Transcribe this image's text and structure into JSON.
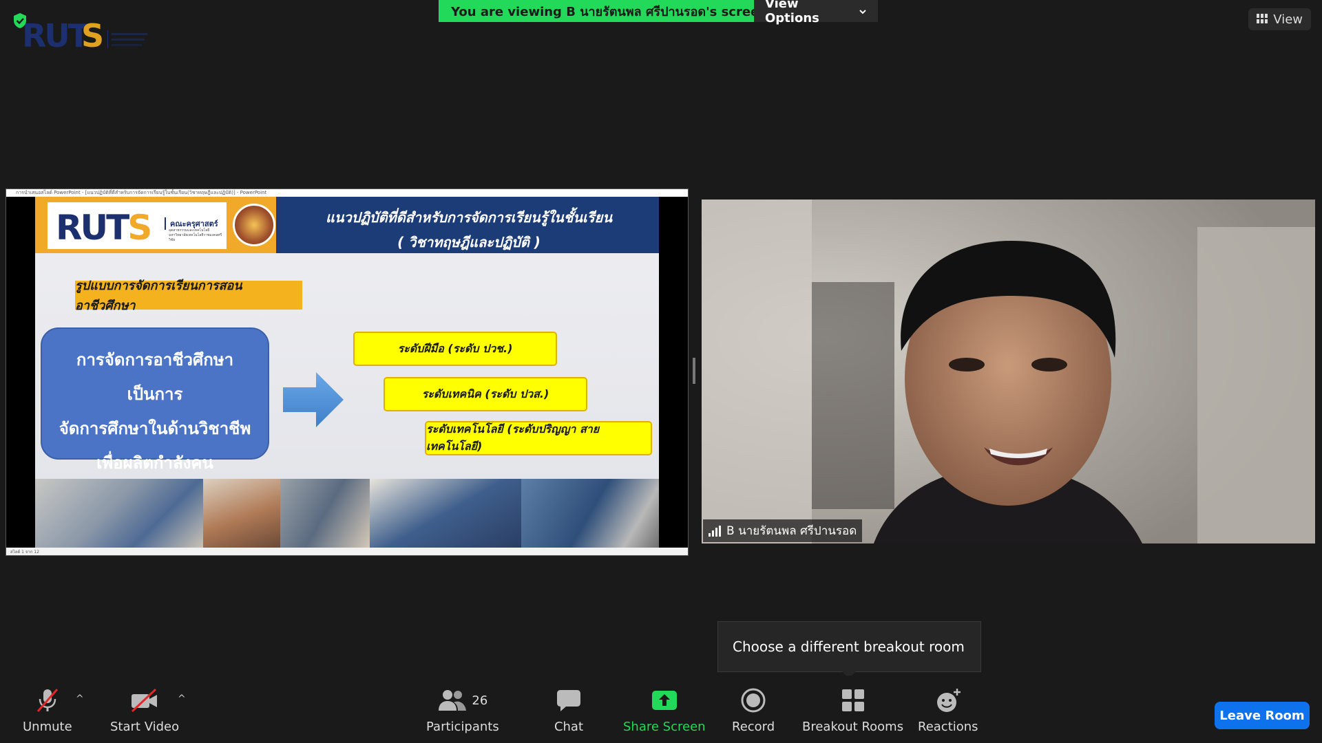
{
  "banner": {
    "viewing_text": "You are viewing B นายรัตนพล ศรีปานรอด's screen",
    "view_options": "View Options"
  },
  "view_button": "View",
  "shared_screen": {
    "titlebar": "การนำเสนอสไลด์ PowerPoint - [แนวปฏิบัติที่ดีสำหรับการจัดการเรียนรู้ในชั้นเรียน(วิชาทฤษฎีและปฏิบัติ)] - PowerPoint",
    "statusbar": "สไลด์ 1 จาก 12",
    "slide": {
      "logo_text": "RUTS",
      "faculty": "คณะครุศาสตร์",
      "faculty_sub": "อุตสาหกรรมและเทคโนโลยี มหาวิทยาลัยเทคโนโลยีราชมงคลศรีวิชัย",
      "title_line1": "แนวปฏิบัติที่ดีสำหรับการจัดการเรียนรู้ในชั้นเรียน",
      "title_line2": "( วิชาทฤษฎีและปฏิบัติ )",
      "tag": "รูปแบบการจัดการเรียนการสอนอาชีวศึกษา",
      "bluebox": [
        "การจัดการอาชีวศึกษา เป็นการ",
        "จัดการศึกษาในด้านวิชาชีพ",
        "เพื่อผลิตกำลังคน"
      ],
      "levels": [
        "ระดับฝีมือ (ระดับ ปวช.)",
        "ระดับเทคนิค (ระดับ ปวส.)",
        "ระดับเทคโนโลยี (ระดับปริญญา สายเทคโนโลยี)"
      ]
    }
  },
  "video": {
    "participant_name": "B นายรัตนพล ศรีปานรอด"
  },
  "tooltip": "Choose a different breakout room",
  "toolbar": {
    "unmute": "Unmute",
    "start_video": "Start Video",
    "participants": "Participants",
    "participants_count": "26",
    "chat": "Chat",
    "share_screen": "Share Screen",
    "record": "Record",
    "breakout_rooms": "Breakout Rooms",
    "reactions": "Reactions",
    "leave_room": "Leave Room"
  },
  "colors": {
    "banner_green": "#23d959",
    "share_green": "#23d959",
    "leave_blue": "#0e72ed",
    "mute_red": "#e02828"
  }
}
